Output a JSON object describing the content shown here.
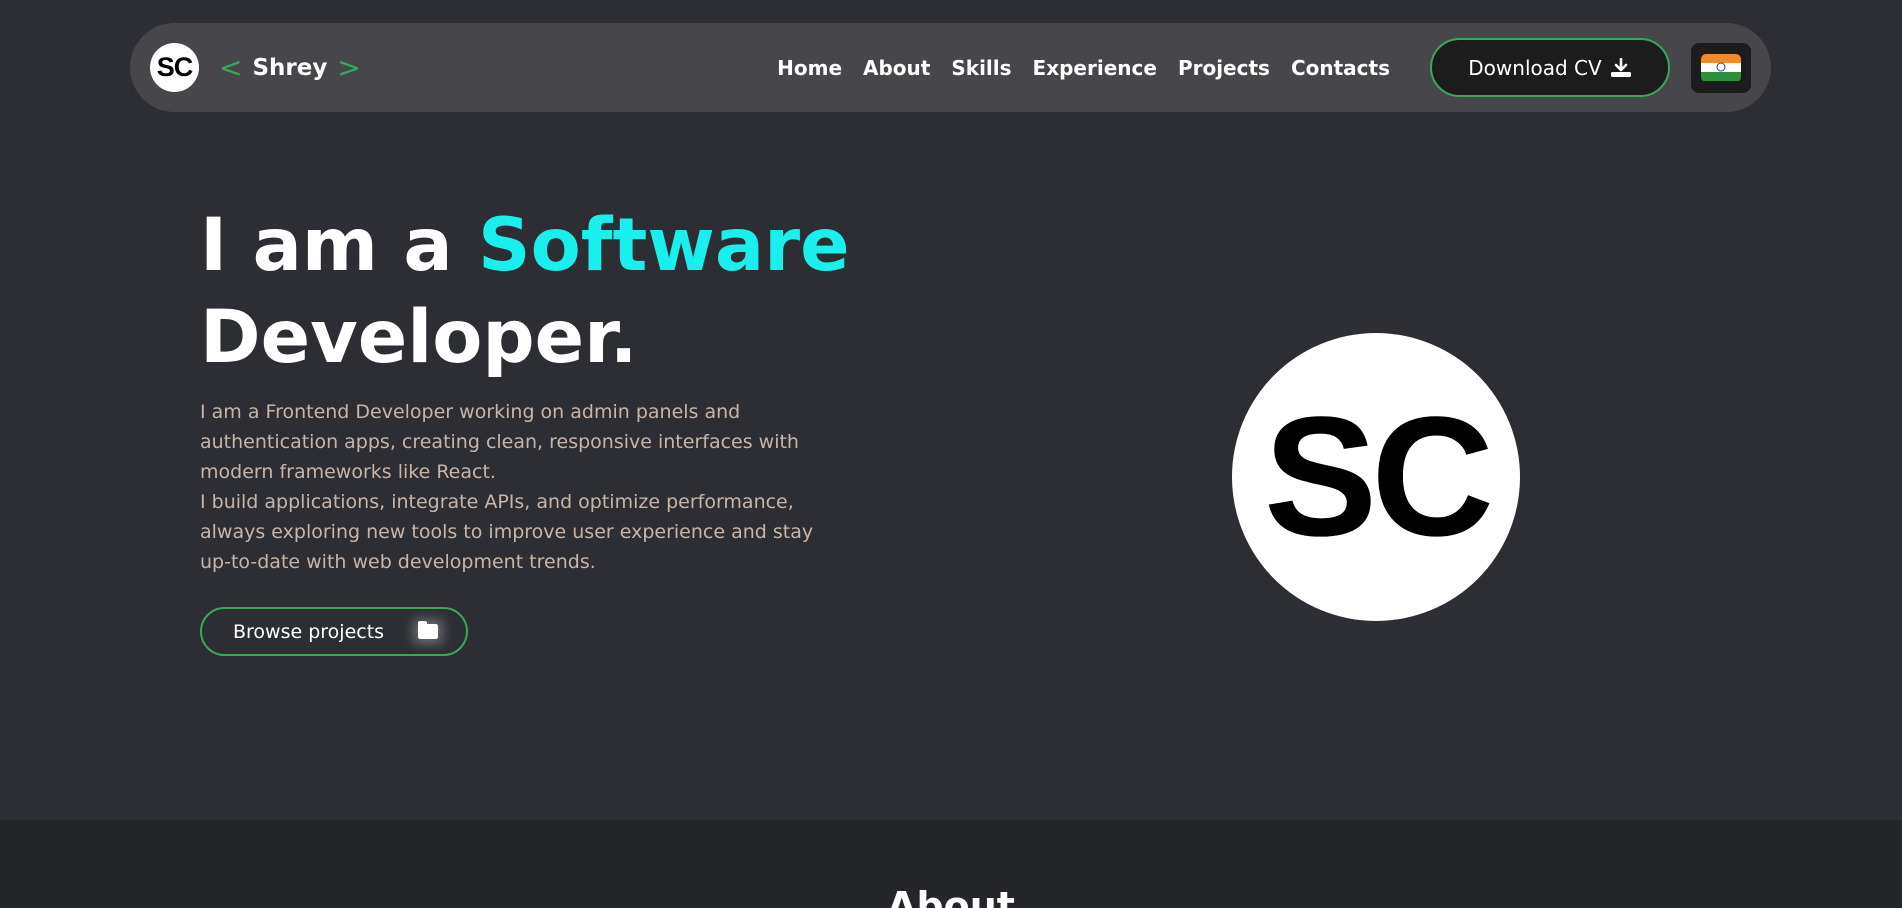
{
  "brand": {
    "logo_text": "SC",
    "open_bracket": "<",
    "name": "Shrey",
    "close_bracket": ">"
  },
  "nav": {
    "links": [
      "Home",
      "About",
      "Skills",
      "Experience",
      "Projects",
      "Contacts"
    ],
    "download_cv_label": "Download CV",
    "download_icon": "download-icon",
    "language_flag": "india-flag-icon"
  },
  "hero": {
    "title_prefix": "I am a ",
    "title_accent": "Software",
    "title_suffix": "Developer.",
    "description_1": "I am a Frontend Developer working on admin panels and authentication apps, creating clean, responsive interfaces with modern frameworks like React.",
    "description_2": "I build applications, integrate APIs, and optimize performance, always exploring new tools to improve user experience and stay up-to-date with web development trends.",
    "browse_label": "Browse projects",
    "browse_icon": "folder-icon",
    "avatar_text": "SC"
  },
  "about": {
    "title": "About"
  },
  "colors": {
    "background": "#2d2e33",
    "navbar": "#47474b",
    "accent_cyan": "#19f0ee",
    "accent_green": "#3aa85a",
    "description_text": "#c8b5a7"
  }
}
